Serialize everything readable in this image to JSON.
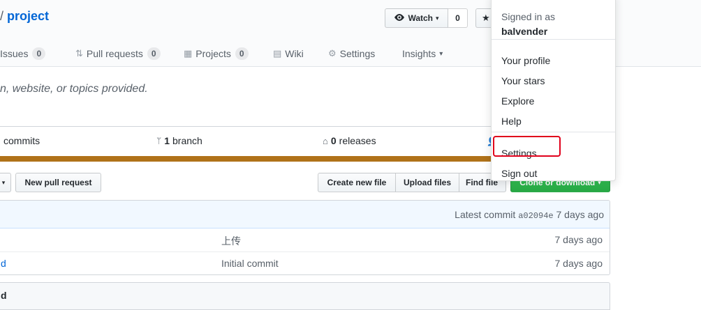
{
  "repo": {
    "separator": "/",
    "name": "project"
  },
  "watch": {
    "label": "Watch",
    "count": "0"
  },
  "tabs": [
    {
      "label": "Issues",
      "count": "0"
    },
    {
      "label": "Pull requests",
      "count": "0"
    },
    {
      "label": "Projects",
      "count": "0"
    },
    {
      "label": "Wiki"
    },
    {
      "label": "Settings"
    },
    {
      "label": "Insights"
    }
  ],
  "description": "n, website, or topics provided.",
  "summary": {
    "commits_label": "commits",
    "branch_count": "1",
    "branch_label": "branch",
    "releases_count": "0",
    "releases_label": "releases"
  },
  "lang_color": "#b07219",
  "buttons": {
    "new_pull_request": "New pull request",
    "create_new_file": "Create new file",
    "upload_files": "Upload files",
    "find_file": "Find file",
    "clone": "Clone or download"
  },
  "commit_bar": {
    "prefix": "Latest commit",
    "sha": "a02094e",
    "age": "7 days ago"
  },
  "files": [
    {
      "name": "",
      "message": "上传",
      "age": "7 days ago"
    },
    {
      "name": "d",
      "message": "Initial commit",
      "age": "7 days ago"
    }
  ],
  "readme_title": "d",
  "dropdown": {
    "signed_in_as": "Signed in as",
    "username": "balvender",
    "items1": [
      "Your profile",
      "Your stars",
      "Explore",
      "Help"
    ],
    "items2": [
      "Settings",
      "Sign out"
    ]
  },
  "highlight_color": "#e0001b"
}
